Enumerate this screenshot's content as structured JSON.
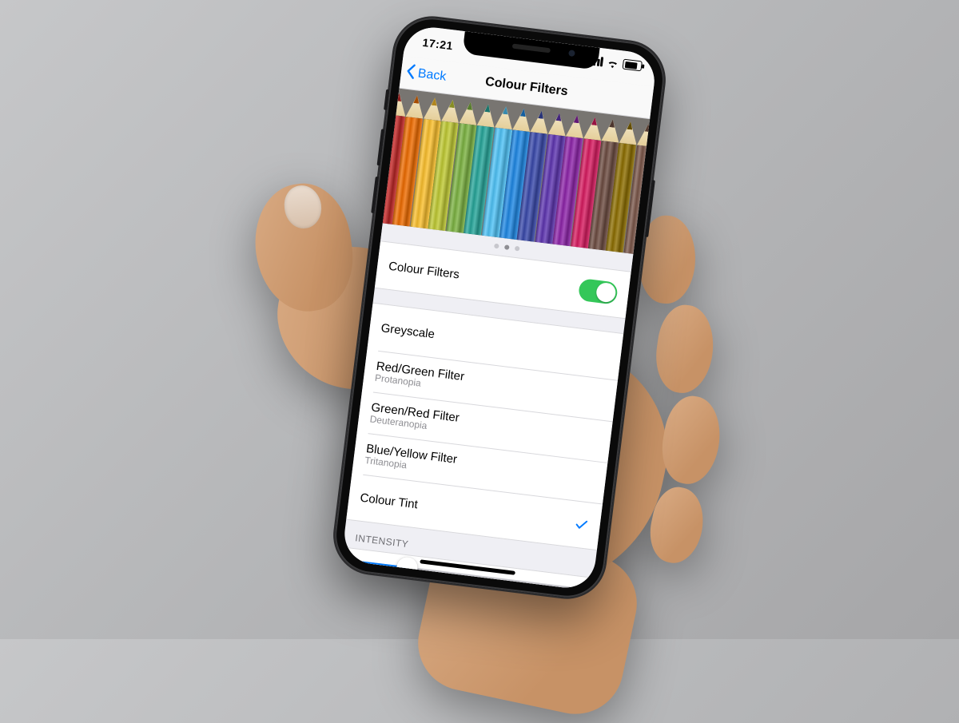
{
  "statusbar": {
    "time": "17:21"
  },
  "nav": {
    "back_label": "Back",
    "title": "Colour Filters"
  },
  "pencil_colors": [
    "#c62828",
    "#ef6c00",
    "#fbc02d",
    "#c0ca33",
    "#7cb342",
    "#26a69a",
    "#4fc3f7",
    "#1e88e5",
    "#3949ab",
    "#5e35b1",
    "#8e24aa",
    "#d81b60",
    "#6d4c41",
    "#8d6e00",
    "#795548"
  ],
  "page_indicator": {
    "count": 3,
    "active": 1
  },
  "toggle_row": {
    "label": "Colour Filters",
    "on": true,
    "on_color": "#34c759"
  },
  "filters": [
    {
      "label": "Greyscale",
      "sub": "",
      "selected": false
    },
    {
      "label": "Red/Green Filter",
      "sub": "Protanopia",
      "selected": false
    },
    {
      "label": "Green/Red Filter",
      "sub": "Deuteranopia",
      "selected": false
    },
    {
      "label": "Blue/Yellow Filter",
      "sub": "Tritanopia",
      "selected": false
    },
    {
      "label": "Colour Tint",
      "sub": "",
      "selected": true
    }
  ],
  "intensity": {
    "header": "INTENSITY",
    "value_pct": 24,
    "track_color": "#c7c7cd",
    "fill_color": "#007aff"
  }
}
